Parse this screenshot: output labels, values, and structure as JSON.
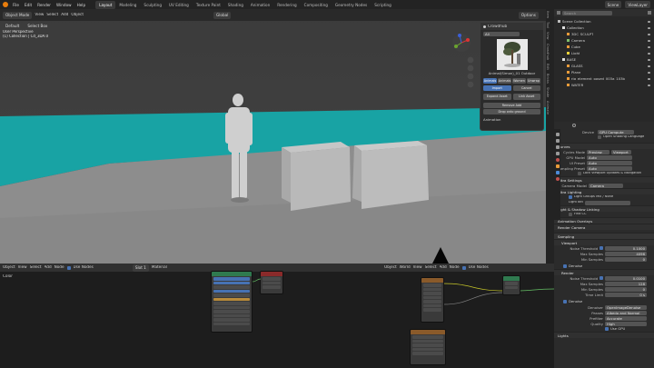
{
  "menu": [
    "File",
    "Edit",
    "Render",
    "Window",
    "Help"
  ],
  "workspace_tabs": [
    {
      "label": "Layout",
      "active": true
    },
    {
      "label": "Modeling",
      "active": false
    },
    {
      "label": "Sculpting",
      "active": false
    },
    {
      "label": "UV Editing",
      "active": false
    },
    {
      "label": "Texture Paint",
      "active": false
    },
    {
      "label": "Shading",
      "active": false
    },
    {
      "label": "Animation",
      "active": false
    },
    {
      "label": "Rendering",
      "active": false
    },
    {
      "label": "Compositing",
      "active": false
    },
    {
      "label": "Geometry Nodes",
      "active": false
    },
    {
      "label": "Scripting",
      "active": false
    }
  ],
  "topbar_right": {
    "scene": "Scene",
    "view_layer": "ViewLayer"
  },
  "viewport": {
    "mode": "Object Mode",
    "menus": [
      "View",
      "Select",
      "Add",
      "Object"
    ],
    "orientation": "Default",
    "drag": "Select Box",
    "transform": "Global",
    "info_line1": "User Perspective",
    "info_line2": "(1) Collection | Cd_3DA.0",
    "options": "Options"
  },
  "assets_popup": {
    "title": "Crowdhub",
    "filter": "All",
    "asset_name": "Animal(Simon)_01 Outdoor",
    "categories": [
      "Animals",
      "Animals",
      "Women",
      "Unwrap"
    ],
    "btn_import": "Import",
    "btn_cancel": "Cancel",
    "btn_expand": "Expand Asset",
    "btn_link": "Link Asset",
    "btn_remove": "Remove Add",
    "btn_drop": "Drop onto ground",
    "section_animation": "Animation"
  },
  "outliner": {
    "search": "Search",
    "items": [
      {
        "label": "Scene Collection",
        "depth": 0
      },
      {
        "label": "Collection",
        "depth": 1
      },
      {
        "label": "3DC_SCULPT",
        "depth": 2
      },
      {
        "label": "Camera",
        "depth": 2
      },
      {
        "label": "Cube",
        "depth": 2
      },
      {
        "label": "Light",
        "depth": 2
      },
      {
        "label": "BASE",
        "depth": 1
      },
      {
        "label": "GLASS",
        "depth": 2
      },
      {
        "label": "Plane",
        "depth": 2
      },
      {
        "label": "rig_element_posed_003a_103b",
        "depth": 2
      },
      {
        "label": "WATER",
        "depth": 2
      }
    ]
  },
  "properties": {
    "device_label": "Device",
    "device_value": "GPU Compute",
    "open_shading": "Open Shading Language",
    "curves_section": "Curves",
    "cycles_mode_label": "Cycles Mode",
    "cycles_mode_value": "Preview",
    "cycles_mode_value2": "Viewport",
    "rows": [
      {
        "label": "GPU Model",
        "value": "Auto"
      },
      {
        "label": "UI Preset",
        "value": "Auto"
      },
      {
        "label": "Sampling Preset",
        "value": "Auto"
      }
    ],
    "lock_viewport": "Lock Viewport Updates & Navigation",
    "ultra_settings": "Ultra Settings",
    "camera_model_label": "Camera Model",
    "camera_model_value": "Camera",
    "ultra_lighting": "Ultra Lighting",
    "light_groups": "Light Groups Mix / None",
    "light_bkt": "Light bkt",
    "light_linking": "Light & Shadow Linking",
    "find_cc": "Find CC",
    "animation_overlays": "Animation Overlays",
    "render_camera": "Render Camera",
    "sampling": "Sampling",
    "viewport": "Viewport",
    "noise_threshold": "Noise Threshold",
    "noise_threshold_val": "0.1000",
    "max_samples": "Max Samples",
    "max_samples_val": "4096",
    "min_samples": "Min Samples",
    "min_samples_val": "0",
    "denoise": "Denoise",
    "render": "Render",
    "noise_threshold_r_val": "0.0100",
    "max_samples_r_val": "128",
    "min_samples_r_val": "0",
    "time_limit": "Time Limit",
    "time_limit_val": "0 s",
    "denoise2": "Denoise",
    "denoiser": "Denoiser",
    "denoiser_val": "OpenImageDenoise",
    "passes": "Passes",
    "passes_val": "Albedo and Normal",
    "prefilter": "Prefilter",
    "prefilter_val": "Accurate",
    "quality": "Quality",
    "quality_val": "High",
    "use_gpu": "Use GPU",
    "lights": "Lights"
  },
  "node_editor_left": {
    "menus": [
      "View",
      "Select",
      "Add",
      "Node"
    ],
    "use_nodes": "Use Nodes",
    "slot": "Slot 1",
    "material": "Material",
    "object": "Object",
    "color": "Color"
  },
  "node_editor_right": {
    "menus": [
      "View",
      "Select",
      "Add",
      "Node"
    ],
    "object": "Object",
    "world": "World",
    "use_nodes": "Use Nodes"
  },
  "sidebar_tabs": [
    "Item",
    "Tool",
    "View",
    "Crowdhub",
    "Edit",
    "Bricks",
    "Shade",
    "Animate"
  ]
}
